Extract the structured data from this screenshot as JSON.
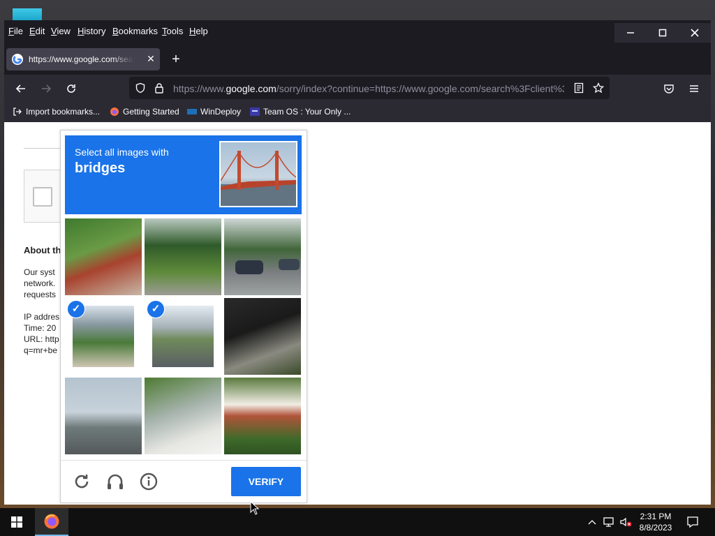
{
  "menubar": {
    "items": [
      "File",
      "Edit",
      "View",
      "History",
      "Bookmarks",
      "Tools",
      "Help"
    ],
    "accel": [
      "F",
      "E",
      "V",
      "H",
      "B",
      "T",
      "H"
    ],
    "rest": [
      "ile",
      "dit",
      "iew",
      "istory",
      "ookmarks",
      "ools",
      "elp"
    ]
  },
  "tab": {
    "title": "https://www.google.com/search?",
    "close_glyph": "✕"
  },
  "newtab_glyph": "+",
  "urlbar": {
    "prefix": "https://www.",
    "domain": "google.com",
    "suffix": "/sorry/index?continue=https://www.google.com/search%3Fclient%3"
  },
  "bookmarks": [
    "Import bookmarks...",
    "Getting Started",
    "WinDeploy",
    "Team OS : Your Only ..."
  ],
  "page": {
    "about_heading": "About th",
    "para1": [
      "Our syst",
      "network.",
      "requests"
    ],
    "para2": [
      "IP addres",
      "Time: 20",
      "URL: http",
      "q=mr+be"
    ]
  },
  "captcha": {
    "instruction": "Select all images with",
    "target": "bridges",
    "verify_label": "VERIFY",
    "tiles_selected": [
      false,
      false,
      false,
      true,
      true,
      false,
      false,
      false,
      false
    ],
    "check_glyph": "✓"
  },
  "taskbar": {
    "time": "2:31 PM",
    "date": "8/8/2023"
  },
  "colors": {
    "captcha_blue": "#1a73e8",
    "browser_dark": "#1c1b22",
    "toolbar": "#2b2a33"
  },
  "icons": [
    "back-icon",
    "forward-icon",
    "reload-icon",
    "shield-icon",
    "lock-icon",
    "reader-view-icon",
    "star-icon",
    "pocket-icon",
    "hamburger-menu-icon",
    "refresh-icon",
    "headphones-icon",
    "info-icon",
    "windows-start-icon",
    "firefox-icon"
  ]
}
